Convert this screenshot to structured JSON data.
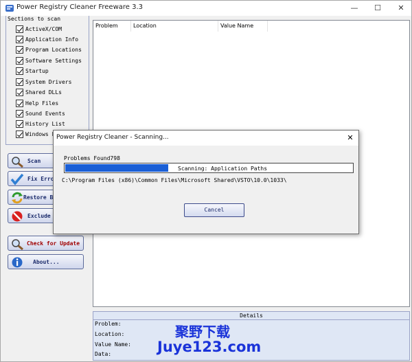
{
  "window": {
    "title": "Power Registry Cleaner Freeware 3.3",
    "controls": {
      "minimize": "—",
      "maximize": "☐",
      "close": "✕"
    }
  },
  "sections": {
    "title": "Sections to scan",
    "items": [
      {
        "label": "ActiveX/COM",
        "checked": true
      },
      {
        "label": "Application Info",
        "checked": true
      },
      {
        "label": "Program Locations",
        "checked": true
      },
      {
        "label": "Software Settings",
        "checked": true
      },
      {
        "label": "Startup",
        "checked": true
      },
      {
        "label": "System Drivers",
        "checked": true
      },
      {
        "label": "Shared DLLs",
        "checked": true
      },
      {
        "label": "Help Files",
        "checked": true
      },
      {
        "label": "Sound Events",
        "checked": true
      },
      {
        "label": "History List",
        "checked": true
      },
      {
        "label": "Windows F",
        "checked": true
      }
    ]
  },
  "buttons": {
    "scan": "Scan",
    "fix": "Fix Erro",
    "restore": "Restore Ba",
    "exclude": "Exclude L",
    "update": "Check for Update",
    "about": "About..."
  },
  "list": {
    "columns": [
      "Problem",
      "Location",
      "Value Name"
    ]
  },
  "details": {
    "header": "Details",
    "labels": [
      "Problem:",
      "Location:",
      "Value Name:",
      "Data:"
    ]
  },
  "dialog": {
    "title": "Power Registry Cleaner - Scanning...",
    "close": "✕",
    "problems_found": "Problems Found798",
    "progress_fraction": 0.36,
    "status": "Scanning: Application Paths",
    "path": "C:\\Program Files (x86)\\Common Files\\Microsoft Shared\\VSTO\\10.0\\1033\\",
    "cancel": "Cancel"
  },
  "watermark": {
    "chinese": "聚野下载",
    "url": "Juye123.com"
  },
  "colors": {
    "progress": "#1a5fd6",
    "watermark": "#1a33d9",
    "update_label": "#a00000"
  }
}
